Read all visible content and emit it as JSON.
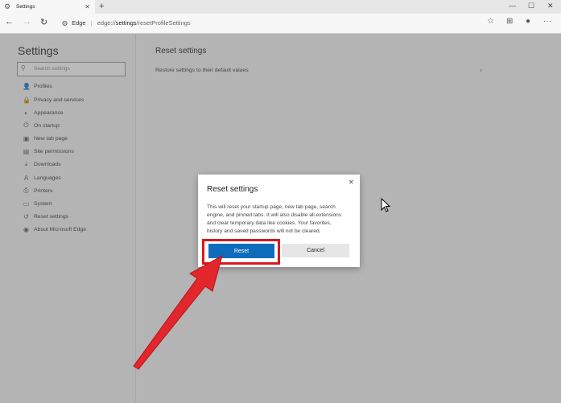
{
  "browser": {
    "tab_title": "Settings",
    "tab_close": "✕",
    "new_tab": "+",
    "window_controls": {
      "minimize": "—",
      "maximize": "☐",
      "close": "✕"
    },
    "nav": {
      "back": "←",
      "forward": "→",
      "refresh": "↻"
    },
    "address": {
      "site_label": "Edge",
      "url_prefix": "edge://",
      "url_bold": "settings",
      "url_suffix": "/resetProfileSettings"
    },
    "toolbar_icons": {
      "favorite": "☆",
      "collections": "⊞",
      "profile": "●",
      "more": "···"
    }
  },
  "sidebar": {
    "title": "Settings",
    "search_placeholder": "Search settings",
    "items": [
      {
        "label": "Profiles",
        "icon": "👤"
      },
      {
        "label": "Privacy and services",
        "icon": "🔒"
      },
      {
        "label": "Appearance",
        "icon": "◐"
      },
      {
        "label": "On startup",
        "icon": "⏻"
      },
      {
        "label": "New tab page",
        "icon": "▣"
      },
      {
        "label": "Site permissions",
        "icon": "▤"
      },
      {
        "label": "Downloads",
        "icon": "⤓"
      },
      {
        "label": "Languages",
        "icon": "A"
      },
      {
        "label": "Printers",
        "icon": "⎙"
      },
      {
        "label": "System",
        "icon": "▭"
      },
      {
        "label": "Reset settings",
        "icon": "↺"
      },
      {
        "label": "About Microsoft Edge",
        "icon": "◉"
      }
    ]
  },
  "main": {
    "title": "Reset settings",
    "restore_label": "Restore settings to their default values",
    "chevron": "›"
  },
  "dialog": {
    "title": "Reset settings",
    "close": "✕",
    "body_lines": [
      "This will reset your startup page, new tab page, search",
      "engine, and pinned tabs. It will also disable all extensions",
      "and clear temporary data like cookies. Your favorites,",
      "history and saved passwords will not be cleared."
    ],
    "reset_label": "Reset",
    "cancel_label": "Cancel"
  },
  "colors": {
    "accent": "#0f6cbd",
    "highlight": "#d71920",
    "arrow": "#e2262b"
  }
}
